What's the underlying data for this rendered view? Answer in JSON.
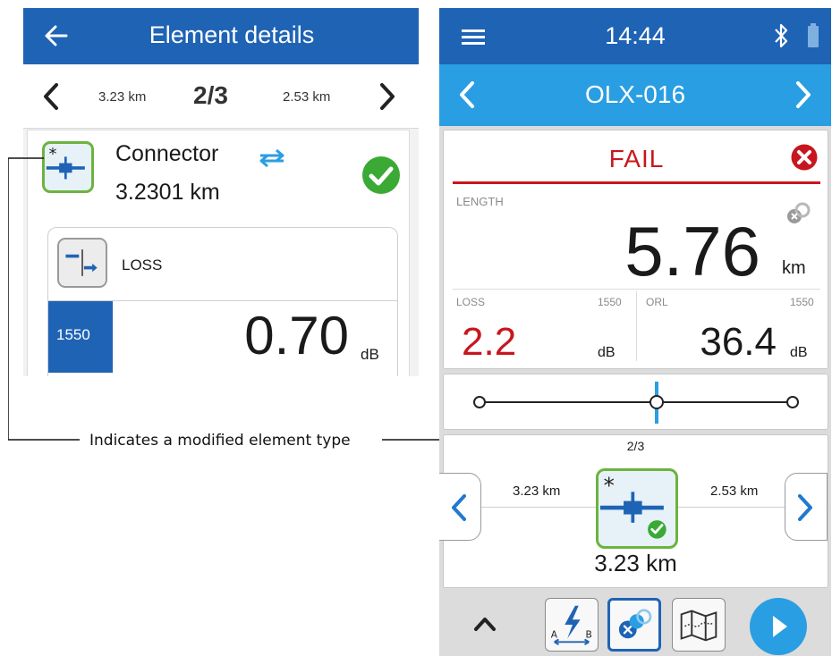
{
  "left_panel": {
    "header": {
      "title": "Element details"
    },
    "nav": {
      "prev_distance": "3.23 km",
      "position": "2/3",
      "next_distance": "2.53 km"
    },
    "element": {
      "modified_marker": "*",
      "type": "Connector",
      "distance": "3.2301 km"
    },
    "loss": {
      "label": "LOSS",
      "wavelength": "1550",
      "value": "0.70",
      "unit": "dB"
    }
  },
  "annotation": {
    "text": "Indicates a modified element type"
  },
  "right_panel": {
    "status_bar": {
      "time": "14:44"
    },
    "title_bar": {
      "name": "OLX-016"
    },
    "result": {
      "status": "FAIL",
      "length_label": "LENGTH",
      "length_value": "5.76",
      "length_unit": "km",
      "loss_label": "LOSS",
      "loss_wavelength": "1550",
      "loss_value": "2.2",
      "loss_unit": "dB",
      "orl_label": "ORL",
      "orl_wavelength": "1550",
      "orl_value": "36.4",
      "orl_unit": "dB"
    },
    "slider": {
      "positions": 3,
      "selected": 2
    },
    "element_view": {
      "position": "2/3",
      "modified_marker": "*",
      "prev_distance": "3.23 km",
      "next_distance": "2.53 km",
      "distance": "3.23 km"
    },
    "toolbar": {
      "ab_label_a": "A",
      "ab_label_b": "B"
    }
  },
  "colors": {
    "header_blue": "#1f63b5",
    "title_blue": "#2a9ee2",
    "fail_red": "#c8161e",
    "pass_green": "#6cb33f"
  }
}
